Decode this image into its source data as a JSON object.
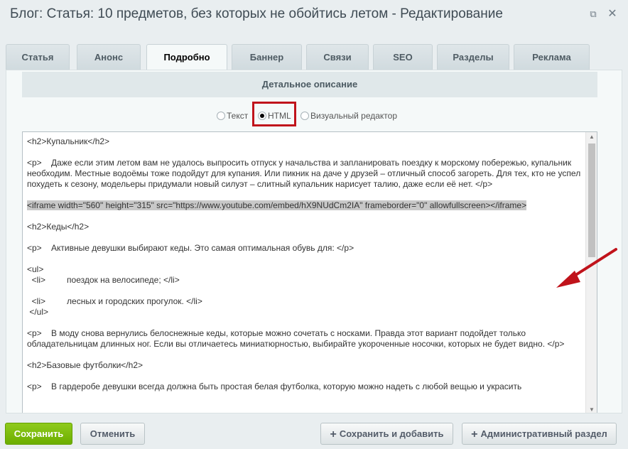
{
  "window": {
    "title": "Блог: Статья: 10 предметов, без которых не обойтись летом - Редактирование"
  },
  "tabs": [
    {
      "label": "Статья"
    },
    {
      "label": "Анонс"
    },
    {
      "label": "Подробно"
    },
    {
      "label": "Баннер"
    },
    {
      "label": "Связи"
    },
    {
      "label": "SEO"
    },
    {
      "label": "Разделы"
    },
    {
      "label": "Реклама"
    }
  ],
  "active_tab": "Подробно",
  "section": {
    "title": "Детальное описание"
  },
  "editor_modes": [
    {
      "label": "Текст",
      "selected": false
    },
    {
      "label": "HTML",
      "selected": true
    },
    {
      "label": "Визуальный редактор",
      "selected": false
    }
  ],
  "editor": {
    "lines": [
      "<h2>Купальник</h2>",
      "",
      "<p>    Даже если этим летом вам не удалось выпросить отпуск у начальства и запланировать поездку к морскому побережью, купальник необходим. Местные водоёмы тоже подойдут для купания. Или пикник на даче у друзей – отличный способ загореть. Для тех, кто не успел похудеть к сезону, модельеры придумали новый силуэт – слитный купальник нарисует талию, даже если её нет. </p>",
      "",
      "<iframe width=\"560\" height=\"315\" src=\"https://www.youtube.com/embed/hX9NUdCm2IA\" frameborder=\"0\" allowfullscreen></iframe>",
      "",
      "<h2>Кеды</h2>",
      "",
      "<p>    Активные девушки выбирают кеды. Это самая оптимальная обувь для: </p>",
      "",
      "<ul>",
      "  <li>         поездок на велосипеде; </li>",
      "",
      "  <li>         лесных и городских прогулок. </li>",
      " </ul>",
      "",
      "<p>    В моду снова вернулись белоснежные кеды, которые можно сочетать с носками. Правда этот вариант подойдет только обладательницам длинных ног. Если вы отличаетесь миниатюрностью, выбирайте укороченные носочки, которых не будет видно. </p>",
      "",
      "<h2>Базовые футболки</h2>",
      "",
      "<p>    В гардеробе девушки всегда должна быть простая белая футболка, которую можно надеть с любой вещью и украсить"
    ],
    "selected_line_index": 4
  },
  "colors": {
    "accent_red": "#c0131b",
    "save_green": "#74b400"
  },
  "icons": {
    "expand": "expand-icon",
    "close": "close-icon",
    "plus": "plus-icon",
    "arrow": "annotation-arrow"
  },
  "footer": {
    "save": "Сохранить",
    "cancel": "Отменить",
    "save_add": "Сохранить и добавить",
    "admin": "Административный раздел"
  }
}
